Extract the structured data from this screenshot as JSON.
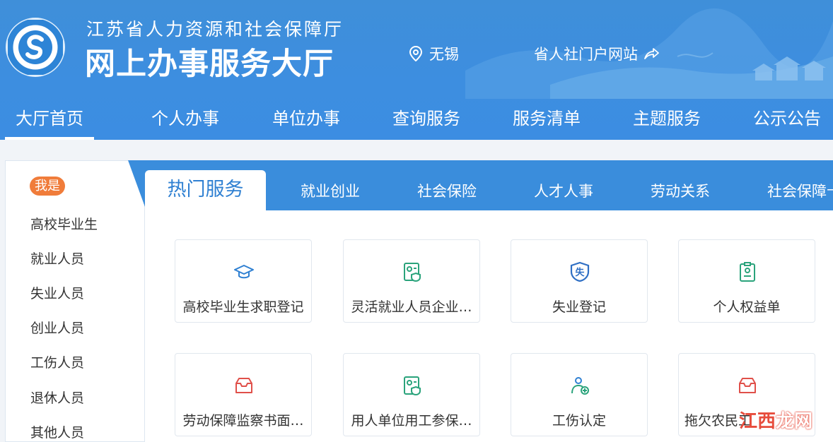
{
  "header": {
    "org_name": "江苏省人力资源和社会保障厅",
    "hall_name": "网上办事服务大厅",
    "location": "无锡",
    "portal_link": "省人社门户网站",
    "colors": {
      "header_blue": "#3d8ee0",
      "accent_orange": "#f07c3a"
    }
  },
  "nav": {
    "items": [
      {
        "label": "大厅首页",
        "active": true
      },
      {
        "label": "个人办事"
      },
      {
        "label": "单位办事"
      },
      {
        "label": "查询服务"
      },
      {
        "label": "服务清单"
      },
      {
        "label": "主题服务"
      },
      {
        "label": "公示公告"
      }
    ]
  },
  "sidebar": {
    "badge": "我是",
    "roles": [
      "高校毕业生",
      "就业人员",
      "失业人员",
      "创业人员",
      "工伤人员",
      "退休人员",
      "其他人员"
    ]
  },
  "services": {
    "tabs": [
      {
        "label": "热门服务",
        "active": true
      },
      {
        "label": "就业创业"
      },
      {
        "label": "社会保险"
      },
      {
        "label": "人才人事"
      },
      {
        "label": "劳动关系"
      },
      {
        "label": "社会保障卡"
      }
    ],
    "cards": [
      {
        "label": "高校毕业生求职登记",
        "icon": "graduation-cap-icon"
      },
      {
        "label": "灵活就业人员企业…",
        "icon": "id-card-shield-icon"
      },
      {
        "label": "失业登记",
        "icon": "unemployment-shield-icon"
      },
      {
        "label": "个人权益单",
        "icon": "clipboard-person-icon"
      },
      {
        "label": "劳动保障监察书面…",
        "icon": "inbox-tray-icon"
      },
      {
        "label": "用人单位用工参保…",
        "icon": "id-card-shield-icon"
      },
      {
        "label": "工伤认定",
        "icon": "injured-person-icon"
      },
      {
        "label": "拖欠农民工",
        "icon": "inbox-tray-icon"
      }
    ]
  },
  "watermark": {
    "text_a": "江西",
    "text_b": "龙网"
  }
}
